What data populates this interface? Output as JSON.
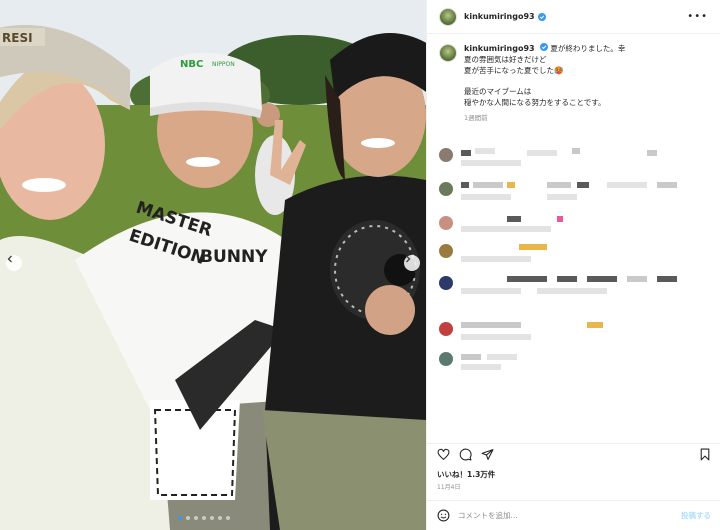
{
  "post": {
    "username": "kinkumiringo93",
    "caption_lines": [
      "夏が終わりました。幸",
      "夏の雰囲気は好きだけど",
      "夏が苦手になった夏でした🥵"
    ],
    "caption_lines_2": [
      "最近のマイブームは",
      "穏やかな人間になる努力をすることです。"
    ],
    "time_ago": "1週間前",
    "likes_text": "いいね！1.3万件",
    "date_text": "11月4日",
    "comment_placeholder": "コメントを追加...",
    "post_label": "投稿する",
    "photo_text": {
      "cap_logo": "NBC",
      "cap_sub": "NIPPON",
      "shirt_line1": "MASTER",
      "shirt_line2": "BUNNY",
      "shirt_line3": "EDITION",
      "left_cap": "RESI"
    }
  },
  "colors": {
    "accent": "#0095f6",
    "verified": "#3897f0",
    "muted": "#8e8e8e"
  },
  "icons": {
    "heart": "heart-icon",
    "comment": "comment-icon",
    "share": "share-icon",
    "save": "bookmark-icon",
    "emoji": "emoji-icon",
    "more": "more-icon"
  },
  "carousel": {
    "slide_count": 7,
    "active_index": 0
  }
}
